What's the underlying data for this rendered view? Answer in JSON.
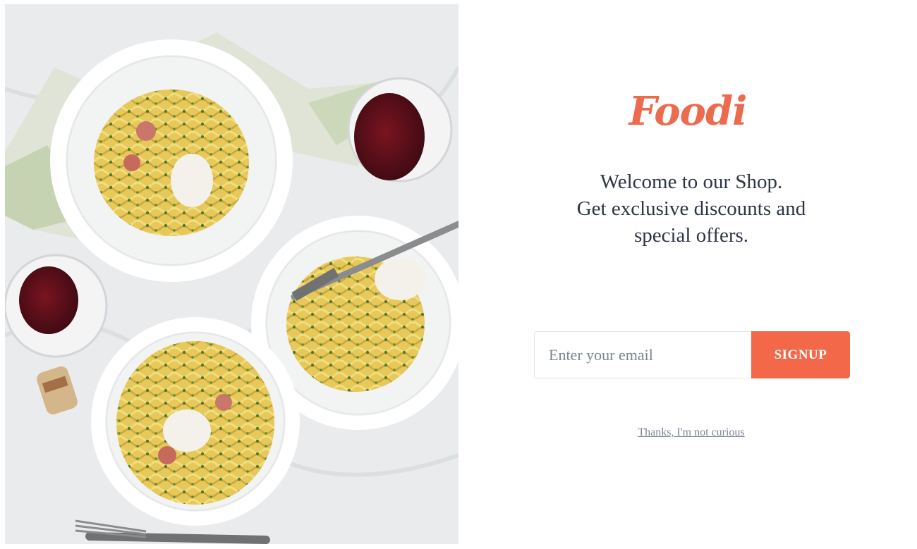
{
  "brand": {
    "logo_text": "Foodi",
    "accent_color": "#ec6a4d"
  },
  "hero_image": {
    "subject_icon": "pasta-dinner-table-photo"
  },
  "popup": {
    "welcome_line1": "Welcome to our Shop.",
    "welcome_line2": "Get exclusive discounts and",
    "welcome_line3": "special offers.",
    "email_placeholder": "Enter your email",
    "email_value": "",
    "signup_label": "SIGNUP",
    "decline_label": "Thanks, I'm not curious",
    "text_color": "#2e3544",
    "muted_color": "#7c8494",
    "signup_color": "#f26848"
  }
}
